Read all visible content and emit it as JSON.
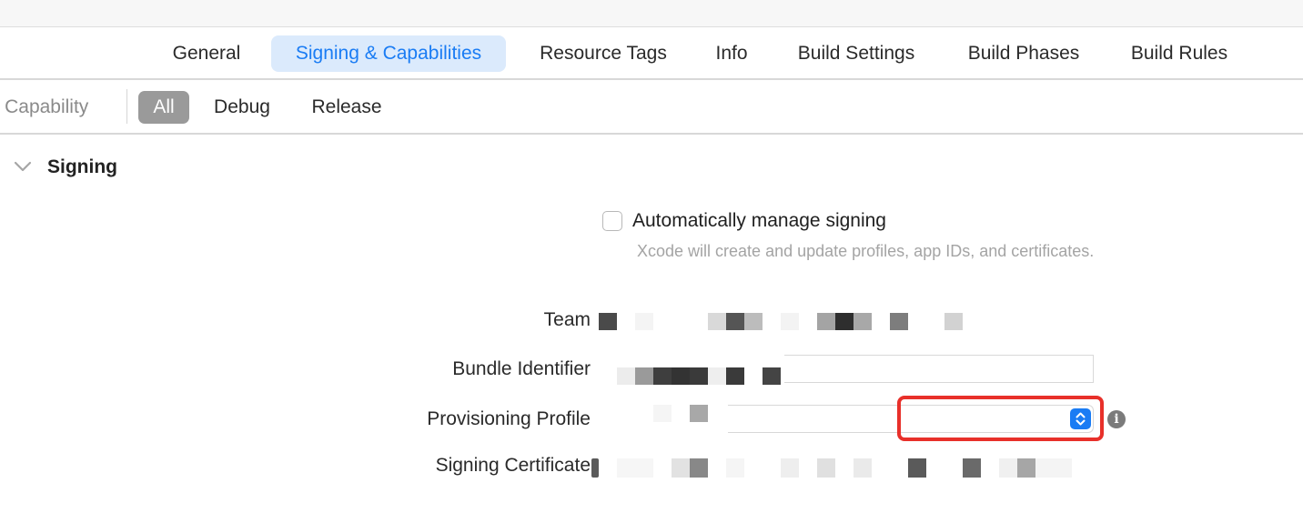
{
  "tabs": [
    {
      "label": "General",
      "selected": false
    },
    {
      "label": "Signing & Capabilities",
      "selected": true
    },
    {
      "label": "Resource Tags",
      "selected": false
    },
    {
      "label": "Info",
      "selected": false
    },
    {
      "label": "Build Settings",
      "selected": false
    },
    {
      "label": "Build Phases",
      "selected": false
    },
    {
      "label": "Build Rules",
      "selected": false
    }
  ],
  "filterbar": {
    "capability_label": "+ Capability",
    "segments": [
      {
        "label": "All",
        "selected": true
      },
      {
        "label": "Debug",
        "selected": false
      },
      {
        "label": "Release",
        "selected": false
      }
    ]
  },
  "signing": {
    "title": "Signing",
    "auto_manage_label": "Automatically manage signing",
    "auto_manage_checked": false,
    "auto_manage_description": "Xcode will create and update profiles, app IDs, and certificates.",
    "team_label": "Team",
    "bundle_identifier_label": "Bundle Identifier",
    "provisioning_profile_label": "Provisioning Profile",
    "signing_certificate_label": "Signing Certificate",
    "info_icon": "i"
  },
  "colors": {
    "accent": "#1a7cf4",
    "selected_tab_bg": "#dbeafc",
    "highlight": "#e8302a",
    "segment_selected": "#9a9a9a"
  },
  "icons": {
    "disclosure": "chevron-down-icon",
    "popup": "up-down-chevron-icon",
    "info": "info-icon"
  }
}
